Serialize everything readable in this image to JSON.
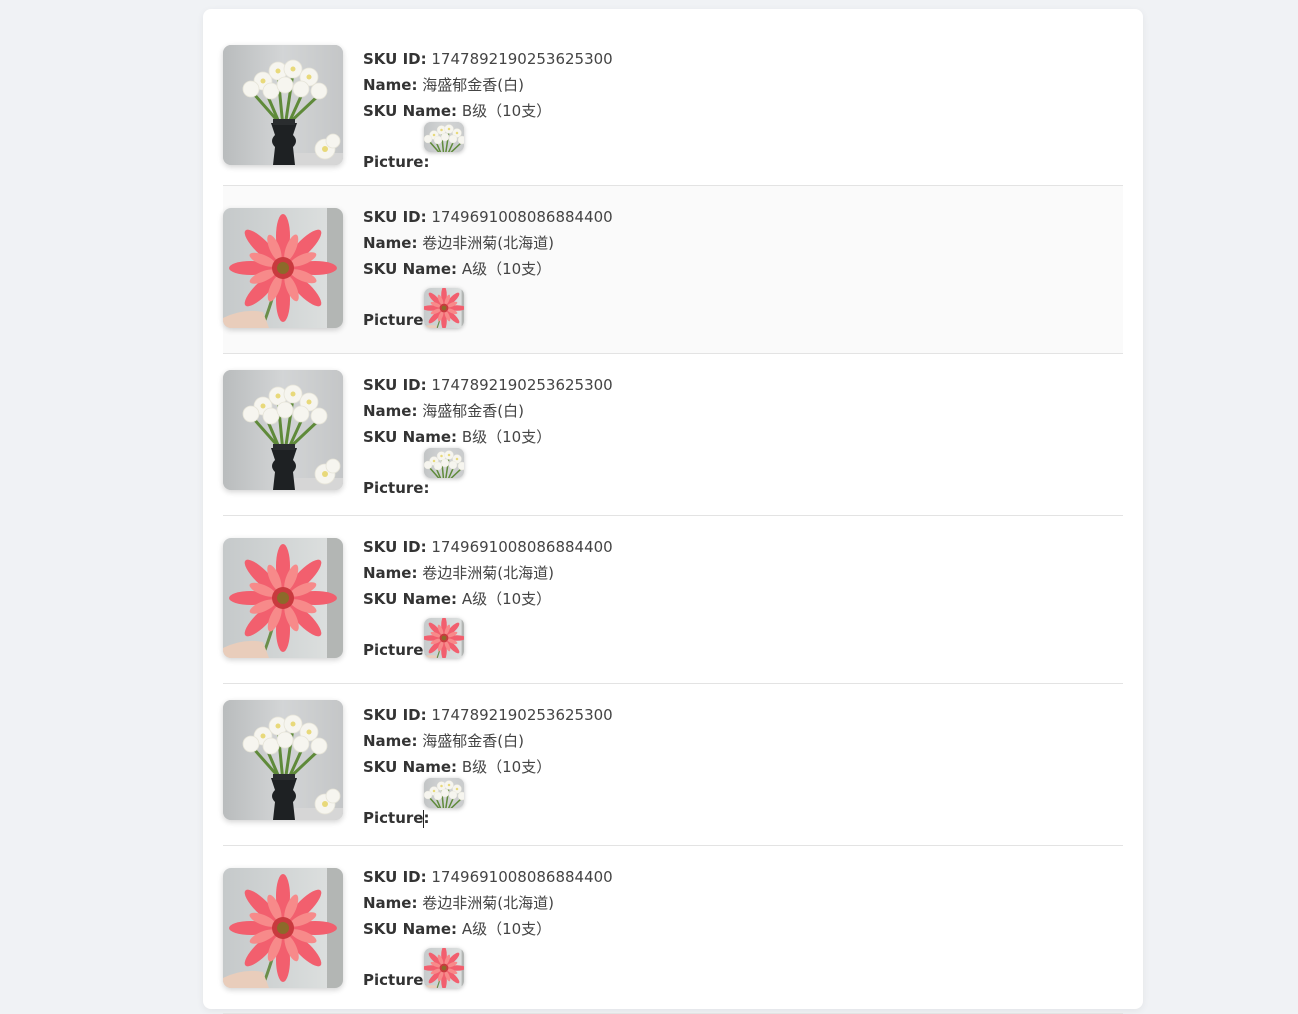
{
  "labels": {
    "sku_id": "SKU ID:",
    "name": "Name:",
    "sku_name": "SKU Name:",
    "picture": "Picture:"
  },
  "items": [
    {
      "sku_id": "1747892190253625300",
      "name": "海盛郁金香(白)",
      "sku_name": "B级（10支）",
      "image": "white-tulip-vase"
    },
    {
      "sku_id": "1749691008086884400",
      "name": "卷边非洲菊(北海道)",
      "sku_name": "A级（10支）",
      "image": "pink-gerbera"
    },
    {
      "sku_id": "1747892190253625300",
      "name": "海盛郁金香(白)",
      "sku_name": "B级（10支）",
      "image": "white-tulip-vase"
    },
    {
      "sku_id": "1749691008086884400",
      "name": "卷边非洲菊(北海道)",
      "sku_name": "A级（10支）",
      "image": "pink-gerbera"
    },
    {
      "sku_id": "1747892190253625300",
      "name": "海盛郁金香(白)",
      "sku_name": "B级（10支）",
      "image": "white-tulip-vase"
    },
    {
      "sku_id": "1749691008086884400",
      "name": "卷边非洲菊(北海道)",
      "sku_name": "A级（10支）",
      "image": "pink-gerbera"
    }
  ]
}
